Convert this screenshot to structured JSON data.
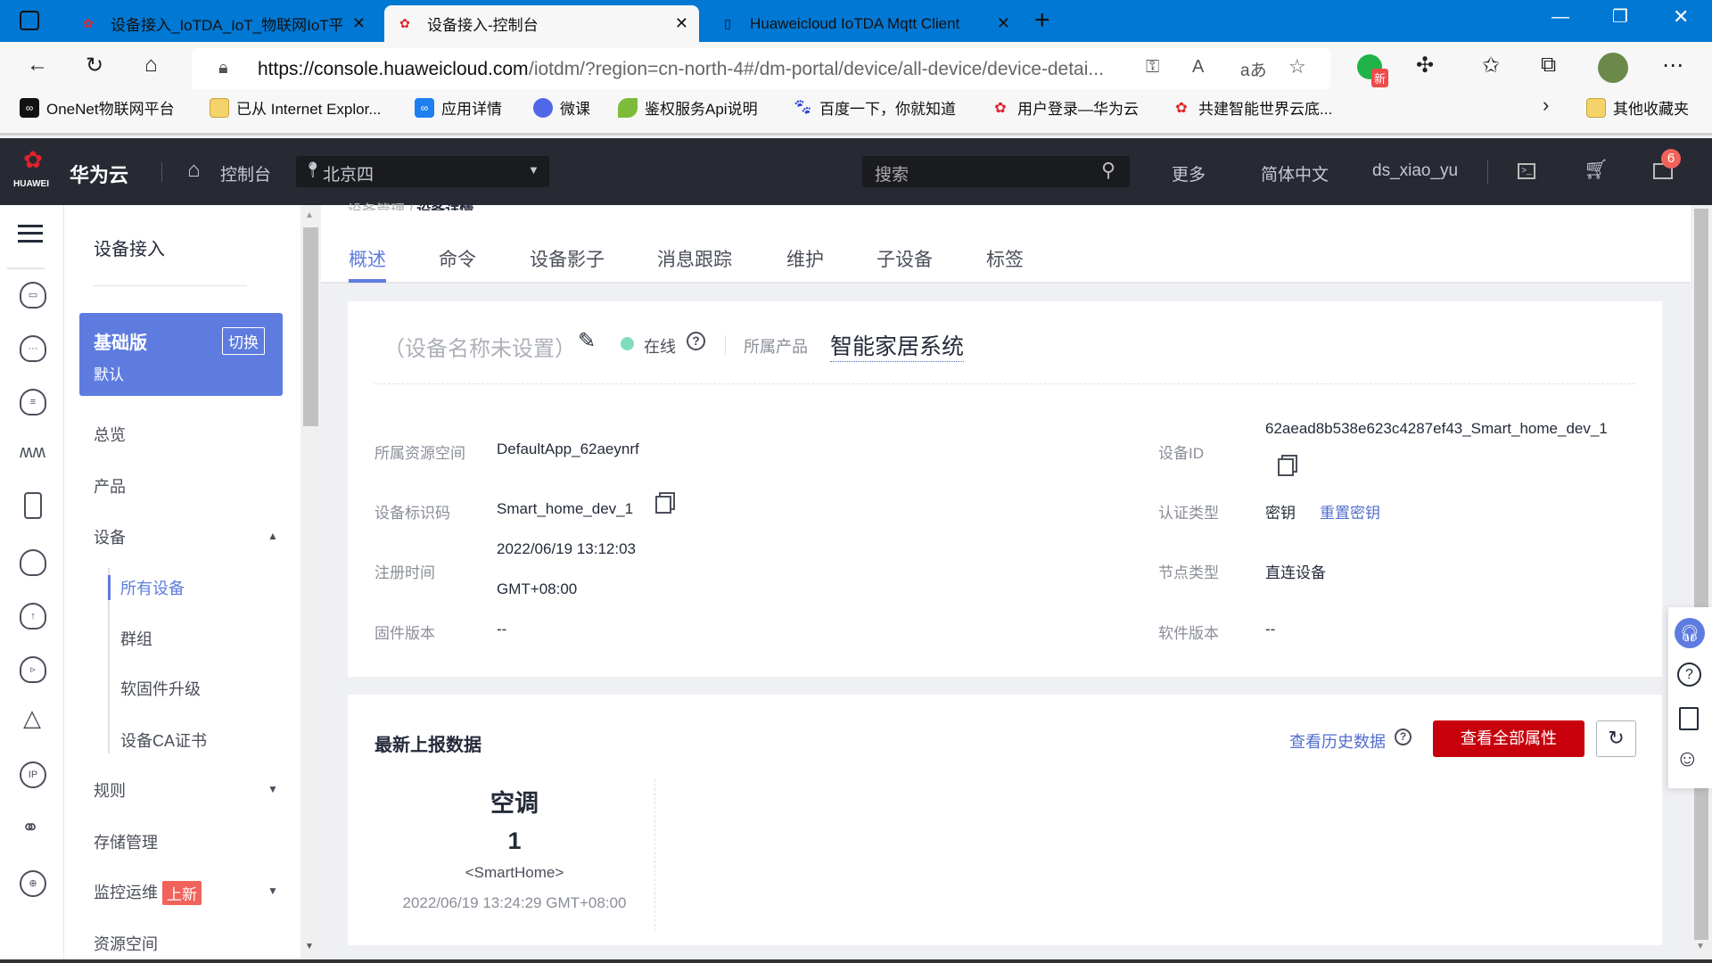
{
  "browser": {
    "tabs": [
      {
        "title": "设备接入_IoTDA_IoT_物联网IoT平",
        "active": false
      },
      {
        "title": "设备接入-控制台",
        "active": true
      },
      {
        "title": "Huaweicloud IoTDA Mqtt Client",
        "active": false
      }
    ],
    "url_host": "https://console.huaweicloud.com",
    "url_path": "/iotdm/?region=cn-north-4#/dm-portal/device/all-device/device-detai...",
    "extension_badge": "新",
    "bookmarks": [
      "OneNet物联网平台",
      "已从 Internet Explor...",
      "应用详情",
      "微课",
      "鉴权服务Api说明",
      "百度一下，你就知道",
      "用户登录—华为云",
      "共建智能世界云底..."
    ],
    "other_bookmarks": "其他收藏夹"
  },
  "header": {
    "logo_text": "HUAWEI",
    "brand": "华为云",
    "console": "控制台",
    "region": "北京四",
    "search_placeholder": "搜索",
    "more": "更多",
    "language": "简体中文",
    "user": "ds_xiao_yu",
    "message_count": "6"
  },
  "sidebar": {
    "title": "设备接入",
    "edition": {
      "name": "基础版",
      "switch": "切换",
      "instance": "默认"
    },
    "items": [
      {
        "label": "总览"
      },
      {
        "label": "产品"
      },
      {
        "label": "设备",
        "expanded": true
      },
      {
        "label": "规则"
      },
      {
        "label": "存储管理"
      },
      {
        "label": "监控运维",
        "badge": "上新"
      },
      {
        "label": "资源空间"
      }
    ],
    "device_sub": [
      "所有设备",
      "群组",
      "软固件升级",
      "设备CA证书"
    ],
    "active_sub": "所有设备"
  },
  "breadcrumb": [
    "设备管理",
    "设备详情"
  ],
  "tabs": [
    "概述",
    "命令",
    "设备影子",
    "消息跟踪",
    "维护",
    "子设备",
    "标签"
  ],
  "active_tab": "概述",
  "device": {
    "name": "（设备名称未设置）",
    "status": "在线",
    "status_color": "#7fdcbf",
    "product_label": "所属产品",
    "product": "智能家居系统",
    "fields": {
      "space_label": "所属资源空间",
      "space": "DefaultApp_62aeynrf",
      "identifier_label": "设备标识码",
      "identifier": "Smart_home_dev_1",
      "reg_label": "注册时间",
      "reg_date": "2022/06/19 13:12:03",
      "reg_tz": "GMT+08:00",
      "fw_label": "固件版本",
      "fw": "--",
      "id_label": "设备ID",
      "id": "62aead8b538e623c4287ef43_Smart_home_dev_1",
      "auth_label": "认证类型",
      "auth": "密钥",
      "reset_key": "重置密钥",
      "node_label": "节点类型",
      "node": "直连设备",
      "sw_label": "软件版本",
      "sw": "--"
    }
  },
  "latest": {
    "title": "最新上报数据",
    "history_link": "查看历史数据",
    "view_all": "查看全部属性",
    "property": {
      "name": "空调",
      "value": "1",
      "service": "<SmartHome>",
      "time": "2022/06/19 13:24:29 GMT+08:00"
    }
  },
  "colors": {
    "accent": "#5e7ce0",
    "primary_button": "#c7000b",
    "header_bg": "#272a33",
    "browser_blue": "#0078d4"
  }
}
